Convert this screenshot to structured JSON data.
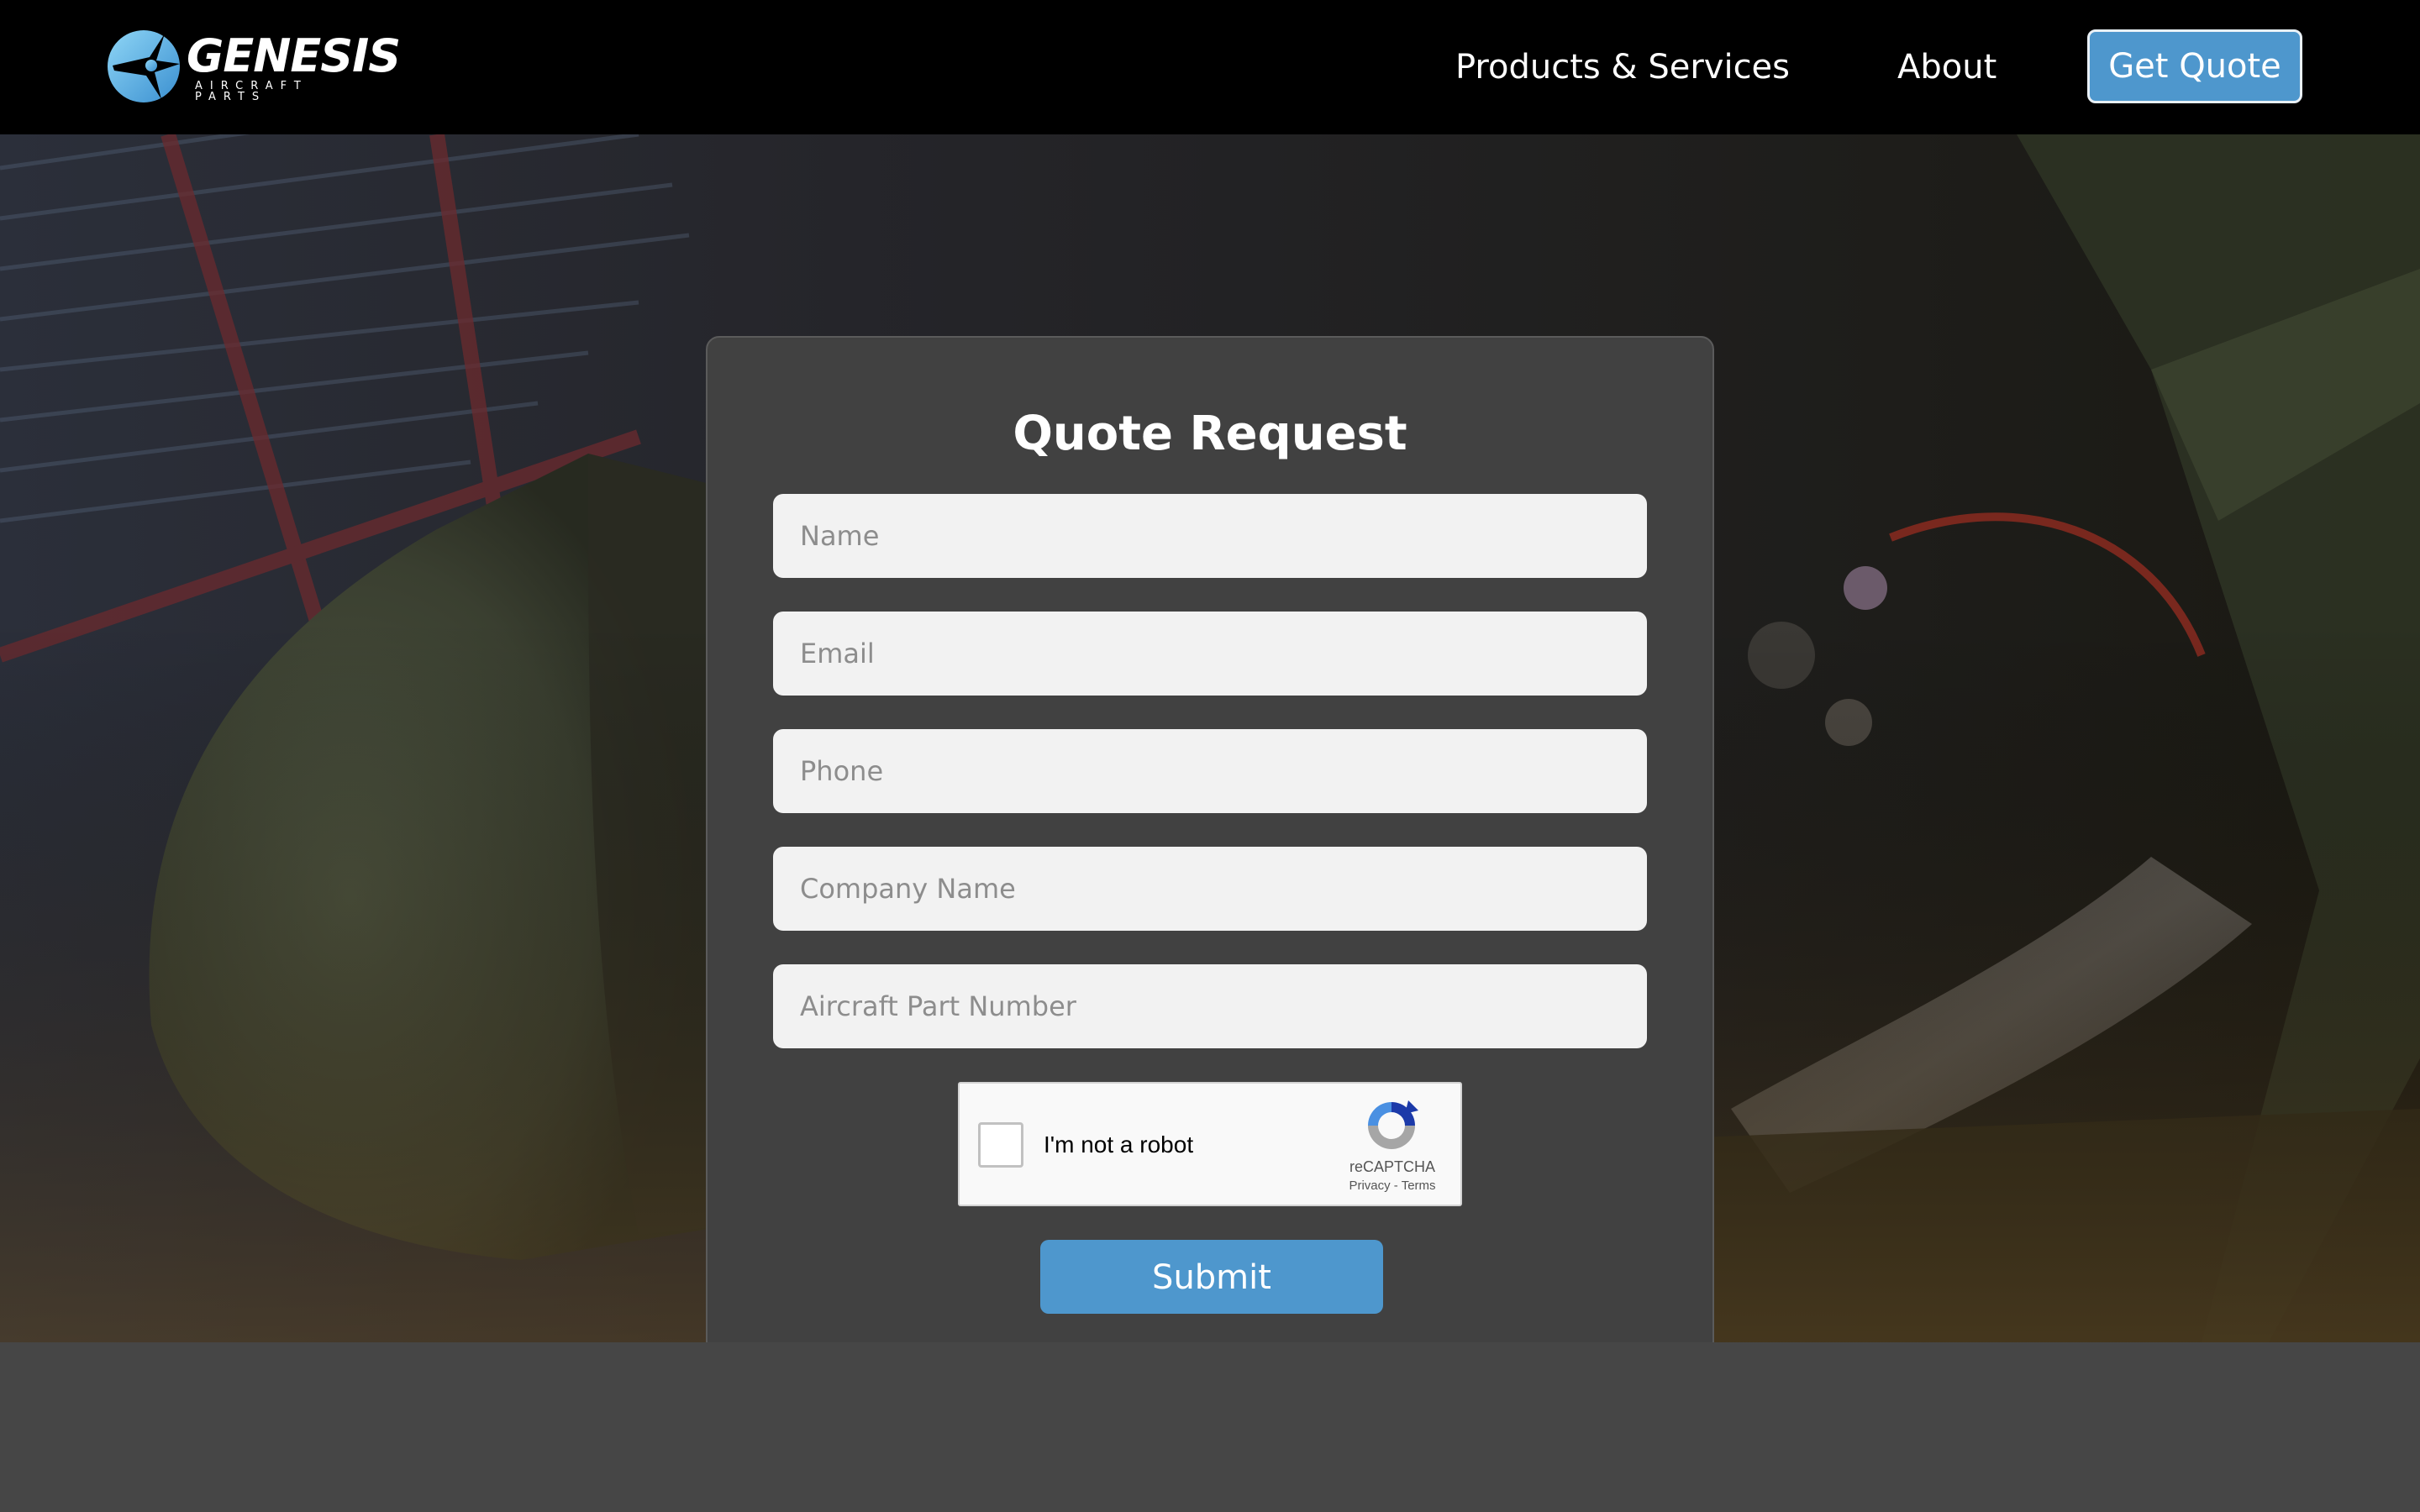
{
  "brand": {
    "name": "GENESIS",
    "tagline": "AIRCRAFT PARTS"
  },
  "nav": {
    "items": [
      {
        "label": "Products & Services"
      },
      {
        "label": "About"
      }
    ],
    "cta_label": "Get Quote"
  },
  "hero": {
    "background_description_icon": "aircraft-engine-photo"
  },
  "form": {
    "title": "Quote Request",
    "fields": [
      {
        "placeholder": "Name",
        "value": ""
      },
      {
        "placeholder": "Email",
        "value": ""
      },
      {
        "placeholder": "Phone",
        "value": ""
      },
      {
        "placeholder": "Company Name",
        "value": ""
      },
      {
        "placeholder": "Aircraft Part Number",
        "value": ""
      }
    ],
    "captcha": {
      "label": "I'm not a robot",
      "brand": "reCAPTCHA",
      "privacy": "Privacy",
      "separator": " - ",
      "terms": "Terms",
      "checked": false
    },
    "submit_label": "Submit"
  },
  "colors": {
    "accent": "#4e97cd",
    "header_bg": "#000000",
    "card_bg": "#414141",
    "footer_bg": "#464646"
  }
}
